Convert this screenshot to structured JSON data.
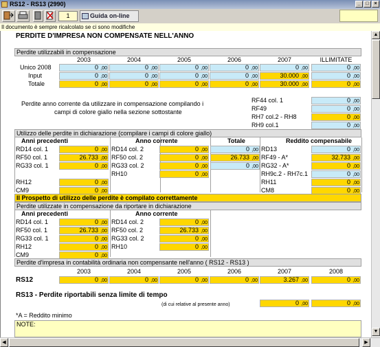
{
  "window": {
    "title": "RS12 - RS13 (2990)"
  },
  "toolbar": {
    "page": "1",
    "guida": "Guida on-line"
  },
  "notice": "Il documento è sempre ricalcolato se ci sono modifiche",
  "main_title": "PERDITE D'IMPRESA NON COMPENSATE NELL'ANNO",
  "sec1": {
    "title": "Perdite utilizzabili in compensazione",
    "years": [
      "2003",
      "2004",
      "2005",
      "2006",
      "2007",
      "ILLIMITATE"
    ],
    "rows": [
      {
        "label": "Unico 2008",
        "values": [
          "0",
          "0",
          "0",
          "0",
          "0",
          "0"
        ]
      },
      {
        "label": "Input",
        "values": [
          "0",
          "0",
          "0",
          "0",
          "30.000",
          "0"
        ]
      },
      {
        "label": "Totale",
        "values": [
          "0",
          "0",
          "0",
          "0",
          "30.000",
          "0"
        ]
      }
    ],
    "text1": "Perdite anno corrente da utilizzare in compensazione compilando i",
    "text2": "campi di colore giallo nella sezione sottostante",
    "side": [
      {
        "label": "RF44 col. 1",
        "value": "0"
      },
      {
        "label": "RF49",
        "value": "0"
      },
      {
        "label": "RH7 col.2 - RH8",
        "value": "0"
      },
      {
        "label": "RH9 col.1",
        "value": "0"
      }
    ]
  },
  "sec2": {
    "title": "Utilizzo delle perdite in dichiarazione (compilare i campi di colore giallo)",
    "heads": [
      "Anni precedenti",
      "Anno corrente",
      "Totale",
      "Reddito compensabile"
    ],
    "rows": [
      {
        "l1": "RD14 col. 1",
        "v1": "0",
        "l2": "RD14 col. 2",
        "v2": "0",
        "v3": "0",
        "l4": "RD13",
        "v4": "0"
      },
      {
        "l1": "RF50 col. 1",
        "v1": "26.733",
        "l2": "RF50 col. 2",
        "v2": "0",
        "v3": "26.733",
        "l4": "RF49 - A*",
        "v4": "32.733"
      },
      {
        "l1": "RG33 col. 1",
        "v1": "0",
        "l2": "RG33 col. 2",
        "v2": "0",
        "v3": "0",
        "l4": "RG32 - A*",
        "v4": "0"
      },
      {
        "l1": "",
        "v1": "",
        "l2": "RH10",
        "v2": "0",
        "v3": "",
        "l4": "RH9c.2 - RH7c.1",
        "v4": "0"
      },
      {
        "l1": "RH12",
        "v1": "0",
        "l2": "",
        "v2": "",
        "v3": "",
        "l4": "RH11",
        "v4": "0"
      },
      {
        "l1": "CM9",
        "v1": "0",
        "l2": "",
        "v2": "",
        "v3": "",
        "l4": "CM8",
        "v4": "0"
      }
    ]
  },
  "status_ok": "Il Prospetto di utilizzo delle perdite è compilato correttamente",
  "sec3": {
    "title": "Perdite utilizzate in compensazione da riportare in dichiarazione",
    "heads": [
      "Anni precedenti",
      "Anno corrente"
    ],
    "rows": [
      {
        "l1": "RD14 col. 1",
        "v1": "0",
        "l2": "RD14 col. 2",
        "v2": "0"
      },
      {
        "l1": "RF50 col. 1",
        "v1": "26.733",
        "l2": "RF50 col. 2",
        "v2": "26.733"
      },
      {
        "l1": "RG33 col. 1",
        "v1": "0",
        "l2": "RG33 col. 2",
        "v2": "0"
      },
      {
        "l1": "RH12",
        "v1": "0",
        "l2": "RH10",
        "v2": "0"
      },
      {
        "l1": "CM9",
        "v1": "0",
        "l2": "",
        "v2": ""
      }
    ]
  },
  "sec4": {
    "title": "Perdite d'impresa in contabilità ordinaria non compensante nell'anno ( RS12 - RS13 )",
    "years": [
      "2003",
      "2004",
      "2005",
      "2006",
      "2007",
      "2008"
    ],
    "rs12_label": "RS12",
    "rs12_values": [
      "0",
      "0",
      "0",
      "0",
      "3.267",
      "0"
    ],
    "rs13_title": "RS13 - Perdite riportabili senza limite di tempo",
    "rs13_sub": "(di cui relative al presente anno)",
    "rs13_values": [
      "0",
      "0"
    ]
  },
  "footnote": "*A = Reddito minimo",
  "note_label": "NOTE:",
  "decimals": ",00"
}
